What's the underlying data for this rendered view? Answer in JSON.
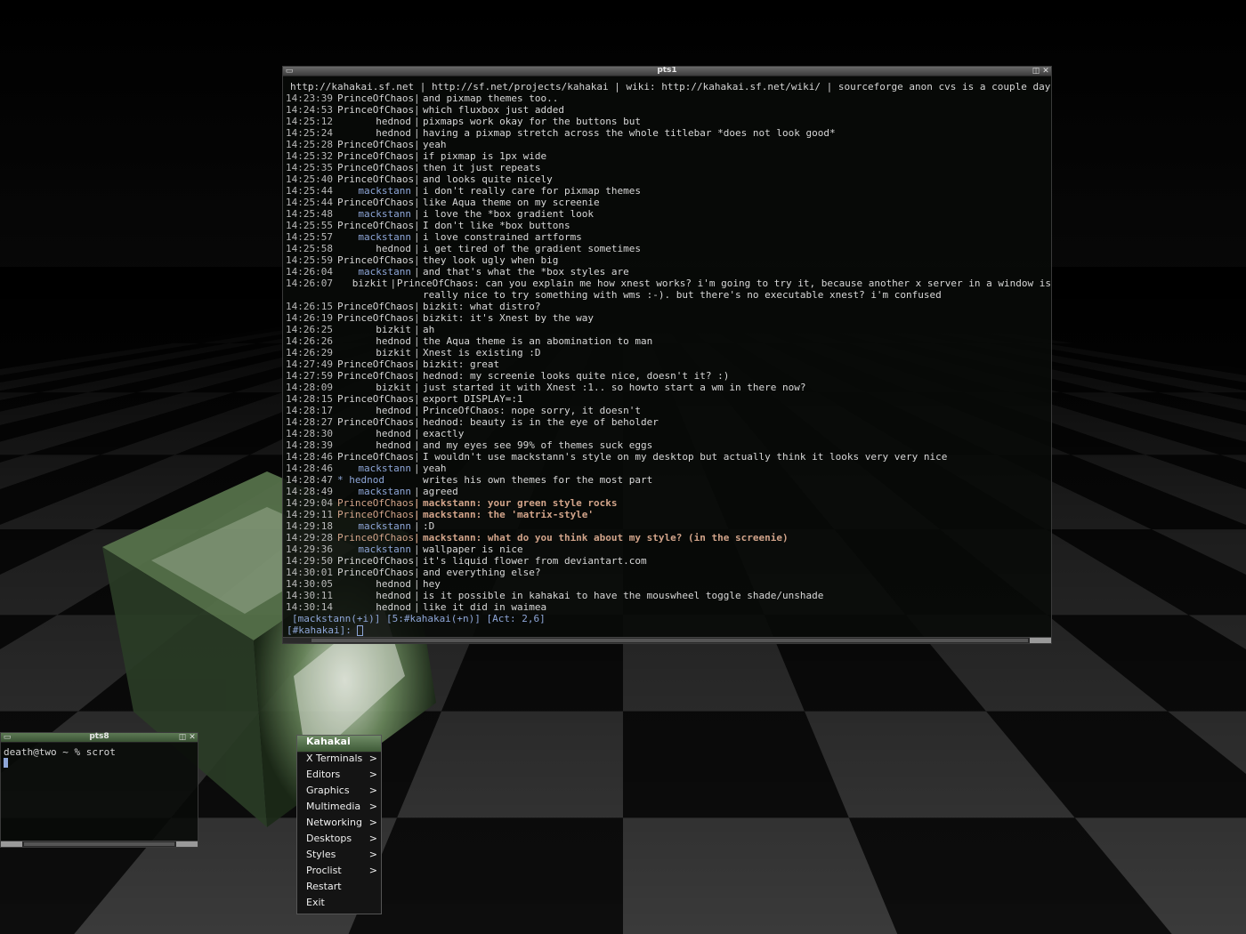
{
  "irc_window": {
    "title": "pts1",
    "topic": "http://kahakai.sf.net | http://sf.net/projects/kahakai | wiki: http://kahakai.sf.net/wiki/ | sourceforge anon cvs is a couple days old, get ho",
    "lines": [
      {
        "ts": "14:23:39",
        "nick": "PrinceOfChaos",
        "msg": "and pixmap themes too.."
      },
      {
        "ts": "14:24:53",
        "nick": "PrinceOfChaos",
        "msg": "which fluxbox just added"
      },
      {
        "ts": "14:25:12",
        "nick": "hednod",
        "msg": "pixmaps work okay for the buttons but"
      },
      {
        "ts": "14:25:24",
        "nick": "hednod",
        "msg": "having a pixmap stretch across the whole titlebar *does not look good*"
      },
      {
        "ts": "14:25:28",
        "nick": "PrinceOfChaos",
        "msg": "yeah"
      },
      {
        "ts": "14:25:32",
        "nick": "PrinceOfChaos",
        "msg": "if pixmap is 1px wide"
      },
      {
        "ts": "14:25:35",
        "nick": "PrinceOfChaos",
        "msg": "then it just repeats"
      },
      {
        "ts": "14:25:40",
        "nick": "PrinceOfChaos",
        "msg": "and looks quite nicely"
      },
      {
        "ts": "14:25:44",
        "nick": "mackstann",
        "msg": "i don't really care for pixmap themes"
      },
      {
        "ts": "14:25:44",
        "nick": "PrinceOfChaos",
        "msg": "like Aqua theme on my screenie"
      },
      {
        "ts": "14:25:48",
        "nick": "mackstann",
        "msg": "i love the *box gradient look"
      },
      {
        "ts": "14:25:55",
        "nick": "PrinceOfChaos",
        "msg": "I don't like *box buttons"
      },
      {
        "ts": "14:25:57",
        "nick": "mackstann",
        "msg": "i love constrained artforms"
      },
      {
        "ts": "14:25:58",
        "nick": "hednod",
        "msg": "i get tired of the gradient sometimes"
      },
      {
        "ts": "14:25:59",
        "nick": "PrinceOfChaos",
        "msg": "they look ugly when big"
      },
      {
        "ts": "14:26:04",
        "nick": "mackstann",
        "msg": "and that's what the *box styles are"
      },
      {
        "ts": "14:26:07",
        "nick": "bizkit",
        "msg": "PrinceOfChaos: can you explain me how xnest works? i'm going to try it, because another x server in a window is"
      },
      {
        "ts": "",
        "nick": "",
        "msg": "really nice to try something with wms :-). but there's no executable xnest? i'm confused",
        "cont": true
      },
      {
        "ts": "14:26:15",
        "nick": "PrinceOfChaos",
        "msg": "bizkit: what distro?"
      },
      {
        "ts": "14:26:19",
        "nick": "PrinceOfChaos",
        "msg": "bizkit: it's Xnest by the way"
      },
      {
        "ts": "14:26:25",
        "nick": "bizkit",
        "msg": "ah"
      },
      {
        "ts": "14:26:26",
        "nick": "hednod",
        "msg": "the Aqua theme is an abomination to man"
      },
      {
        "ts": "14:26:29",
        "nick": "bizkit",
        "msg": "Xnest is existing :D"
      },
      {
        "ts": "14:27:49",
        "nick": "PrinceOfChaos",
        "msg": "bizkit: great"
      },
      {
        "ts": "14:27:59",
        "nick": "PrinceOfChaos",
        "msg": "hednod: my screenie looks quite nice, doesn't it? :)"
      },
      {
        "ts": "14:28:09",
        "nick": "bizkit",
        "msg": "just started it with Xnest :1.. so howto start a wm in there now?"
      },
      {
        "ts": "14:28:15",
        "nick": "PrinceOfChaos",
        "msg": "export DISPLAY=:1"
      },
      {
        "ts": "14:28:17",
        "nick": "hednod",
        "msg": "PrinceOfChaos: nope sorry, it doesn't"
      },
      {
        "ts": "14:28:27",
        "nick": "PrinceOfChaos",
        "msg": "hednod: beauty is in the eye of beholder"
      },
      {
        "ts": "14:28:30",
        "nick": "hednod",
        "msg": "exactly"
      },
      {
        "ts": "14:28:39",
        "nick": "hednod",
        "msg": "and my eyes see 99% of themes suck eggs"
      },
      {
        "ts": "14:28:46",
        "nick": "PrinceOfChaos",
        "msg": "I wouldn't use mackstann's style on my desktop but actually think it looks very very nice"
      },
      {
        "ts": "14:28:46",
        "nick": "mackstann",
        "msg": "yeah"
      },
      {
        "ts": "14:28:47",
        "nick": "* hednod",
        "msg": "writes his own themes for the most part",
        "action": true
      },
      {
        "ts": "14:28:49",
        "nick": "mackstann",
        "msg": "agreed"
      },
      {
        "ts": "14:29:04",
        "nick": "PrinceOfChaos",
        "msg": "mackstann: your green style rocks",
        "hl": true
      },
      {
        "ts": "14:29:11",
        "nick": "PrinceOfChaos",
        "msg": "mackstann: the 'matrix-style'",
        "hl": true
      },
      {
        "ts": "14:29:18",
        "nick": "mackstann",
        "msg": ":D"
      },
      {
        "ts": "14:29:28",
        "nick": "PrinceOfChaos",
        "msg": "mackstann: what do you think about my style? (in the screenie)",
        "hl": true
      },
      {
        "ts": "14:29:36",
        "nick": "mackstann",
        "msg": "wallpaper is nice"
      },
      {
        "ts": "14:29:50",
        "nick": "PrinceOfChaos",
        "msg": "it's liquid flower from deviantart.com"
      },
      {
        "ts": "14:30:01",
        "nick": "PrinceOfChaos",
        "msg": "and everything else?"
      },
      {
        "ts": "14:30:05",
        "nick": "hednod",
        "msg": "hey"
      },
      {
        "ts": "14:30:11",
        "nick": "hednod",
        "msg": "is it possible in kahakai to have the mouswheel toggle shade/unshade"
      },
      {
        "ts": "14:30:14",
        "nick": "hednod",
        "msg": "like it did in waimea"
      }
    ],
    "status_bar": "[mackstann(+i)] [5:#kahakai(+n)] [Act: 2,6]",
    "prompt": "[#kahakai]: "
  },
  "small_terminal": {
    "title": "pts8",
    "prompt_line": "death@two ~ % scrot"
  },
  "root_menu": {
    "title": "Kahakai",
    "items": [
      {
        "label": "X Terminals",
        "submenu": true
      },
      {
        "label": "Editors",
        "submenu": true
      },
      {
        "label": "Graphics",
        "submenu": true
      },
      {
        "label": "Multimedia",
        "submenu": true
      },
      {
        "label": "Networking",
        "submenu": true
      },
      {
        "label": "Desktops",
        "submenu": true
      },
      {
        "label": "Styles",
        "submenu": true
      },
      {
        "label": "Proclist",
        "submenu": true
      },
      {
        "label": "Restart",
        "submenu": false
      },
      {
        "label": "Exit",
        "submenu": false
      }
    ],
    "submenu_arrow": ">"
  },
  "icons": {
    "shade_button": "shade-icon",
    "maximize_button": "maximize-icon",
    "close_button": "close-icon"
  },
  "colors": {
    "accent_green": "#4f6b48",
    "nick_blue": "#8ea6d8",
    "highlight": "#d2a48a"
  }
}
